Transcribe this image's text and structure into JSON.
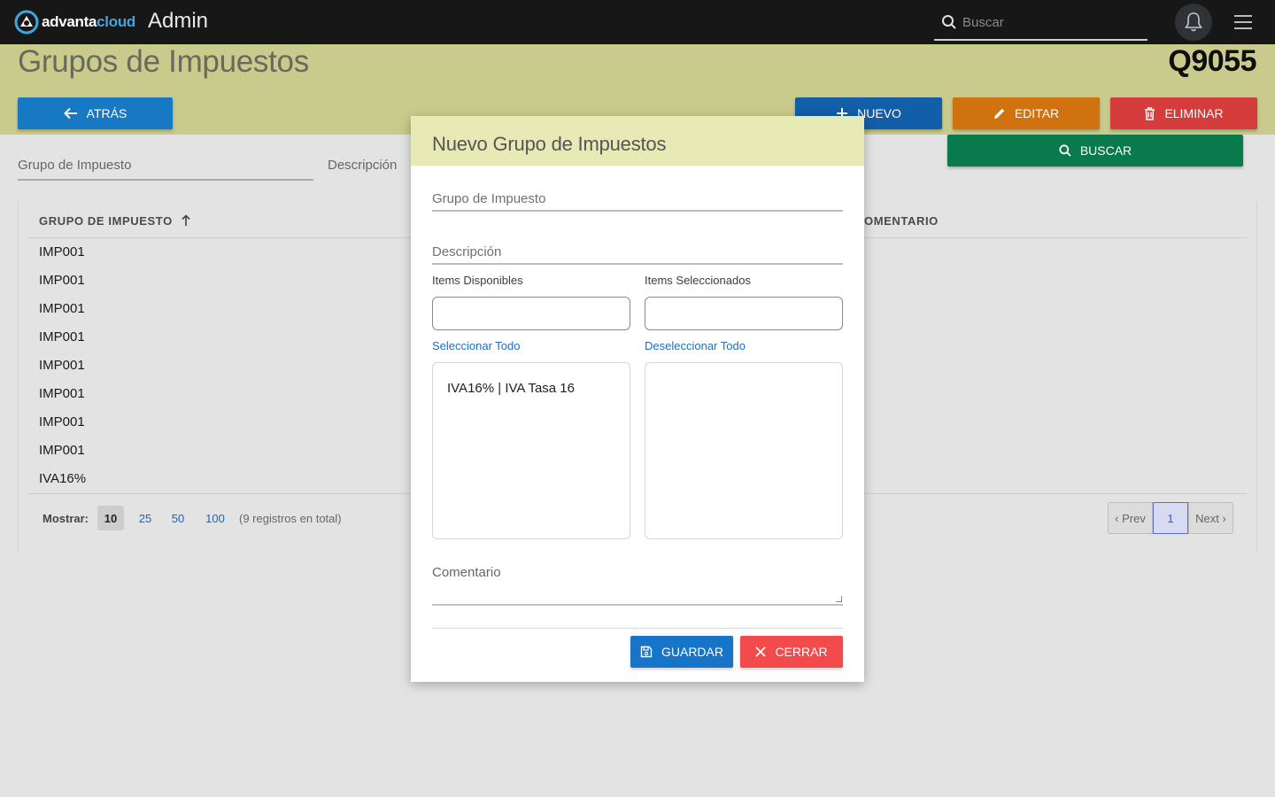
{
  "topbar": {
    "logo_part1": "advanta",
    "logo_part2": "cloud",
    "app_title": "Admin",
    "search_placeholder": "Buscar"
  },
  "header": {
    "title": "Grupos de Impuestos",
    "code": "Q9055",
    "back_label": "ATRÁS",
    "new_label": "NUEVO",
    "edit_label": "EDITAR",
    "delete_label": "ELIMINAR",
    "search_label": "BUSCAR"
  },
  "filters": {
    "group_label": "Grupo de Impuesto",
    "description_label": "Descripción"
  },
  "table": {
    "col_group": "GRUPO DE IMPUESTO",
    "col_comment": "OMENTARIO",
    "rows": [
      "IMP001",
      "IMP001",
      "IMP001",
      "IMP001",
      "IMP001",
      "IMP001",
      "IMP001",
      "IMP001",
      "IVA16%"
    ]
  },
  "pagination": {
    "show_label": "Mostrar:",
    "sizes": [
      "10",
      "25",
      "50",
      "100"
    ],
    "total": "(9 registros en total)",
    "prev": "‹ Prev",
    "current": "1",
    "next": "Next ›"
  },
  "modal": {
    "title": "Nuevo Grupo de Impuestos",
    "group_label": "Grupo de Impuesto",
    "description_label": "Descripción",
    "available_label": "Items Disponibles",
    "selected_label": "Items Seleccionados",
    "select_all": "Seleccionar Todo",
    "deselect_all": "Deseleccionar Todo",
    "available_items": [
      "IVA16% | IVA Tasa 16"
    ],
    "comment_label": "Comentario",
    "save_label": "GUARDAR",
    "close_label": "CERRAR"
  },
  "colors": {
    "topbar": "#171717",
    "header_band": "#c9cb8d",
    "back": "#1778c4",
    "new": "#125ea8",
    "edit": "#d07210",
    "delete": "#d53c3c",
    "search": "#087a4c",
    "modal_header": "#e8eab5",
    "save": "#1675c9",
    "close": "#f34b4b"
  }
}
